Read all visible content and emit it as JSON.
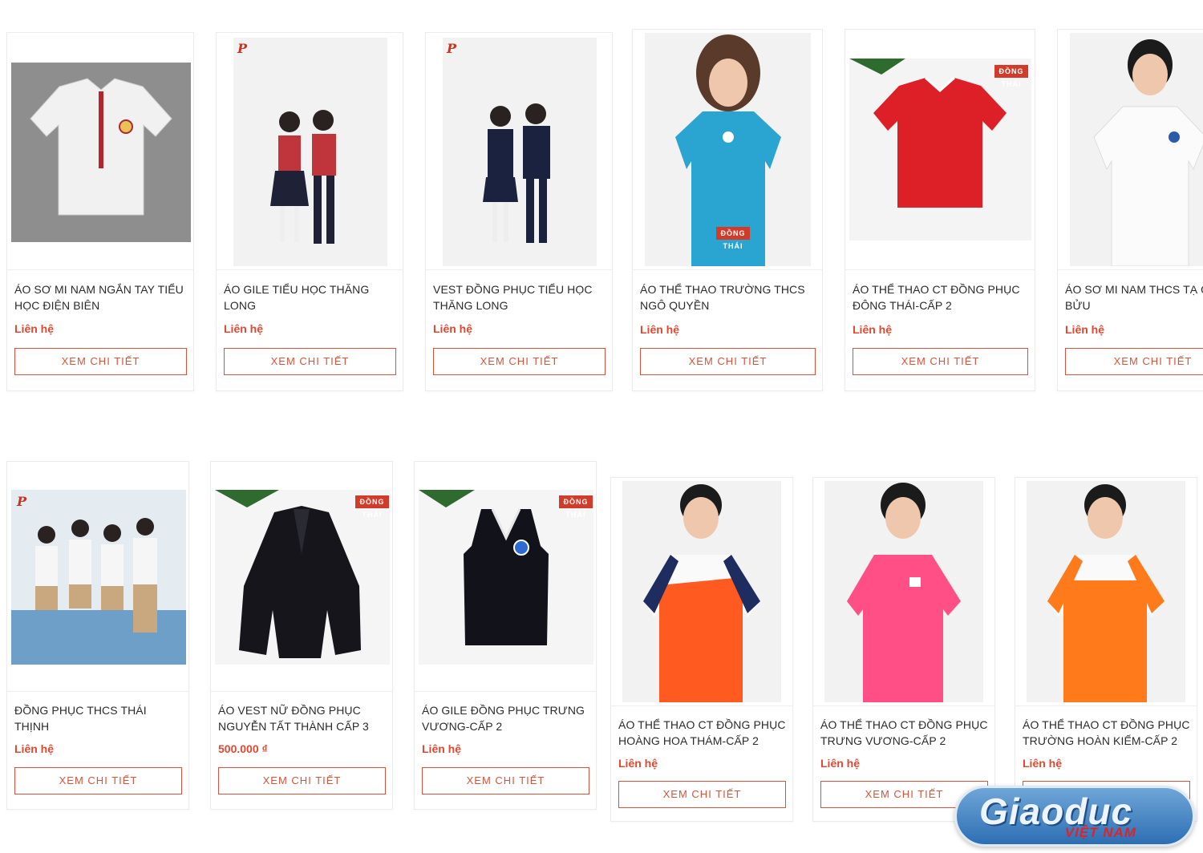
{
  "button_label": "XEM CHI TIẾT",
  "products": [
    {
      "title": "ÁO SƠ MI NAM NGẮN TAY TIỂU HỌC ĐIỆN BIÊN",
      "price": "Liên hệ"
    },
    {
      "title": "ÁO GILE TIỂU HỌC THĂNG LONG",
      "price": "Liên hệ"
    },
    {
      "title": "VEST ĐỒNG PHỤC TIỂU HỌC THĂNG LONG",
      "price": "Liên hệ"
    },
    {
      "title": "ÁO THỂ THAO TRƯỜNG THCS NGÔ QUYỀN",
      "price": "Liên hệ"
    },
    {
      "title": "ÁO THỂ THAO CT ĐỒNG PHỤC ĐÔNG THÁI-CẤP 2",
      "price": "Liên hệ"
    },
    {
      "title": "ÁO SƠ MI NAM THCS TẠ QU BỬU",
      "price": "Liên hệ"
    },
    {
      "title": "ĐỒNG PHỤC THCS THÁI THỊNH",
      "price": "Liên hệ"
    },
    {
      "title": "ÁO VEST NỮ ĐỒNG PHỤC NGUYỄN TẤT THÀNH CẤP 3",
      "price": "500.000 ₫"
    },
    {
      "title": "ÁO GILE ĐỒNG PHỤC TRƯNG VƯƠNG-CẤP 2",
      "price": "Liên hệ"
    },
    {
      "title": "ÁO THỂ THAO CT ĐỒNG PHỤC HOÀNG HOA THÁM-CẤP 2",
      "price": "Liên hệ"
    },
    {
      "title": "ÁO THỂ THAO CT ĐỒNG PHỤC TRƯNG VƯƠNG-CẤP 2",
      "price": "Liên hệ"
    },
    {
      "title": "ÁO THỂ THAO CT ĐỒNG PHỤC TRƯỜNG HOÀN KIẾM-CẤP 2",
      "price": "Liên hệ"
    }
  ],
  "brand_badge": "ĐỒNG THÁI",
  "watermark": {
    "main": "Giaoduc",
    "sub": "VIỆT NAM"
  },
  "colors": {
    "accent": "#d9533a",
    "price": "#e0482f"
  }
}
